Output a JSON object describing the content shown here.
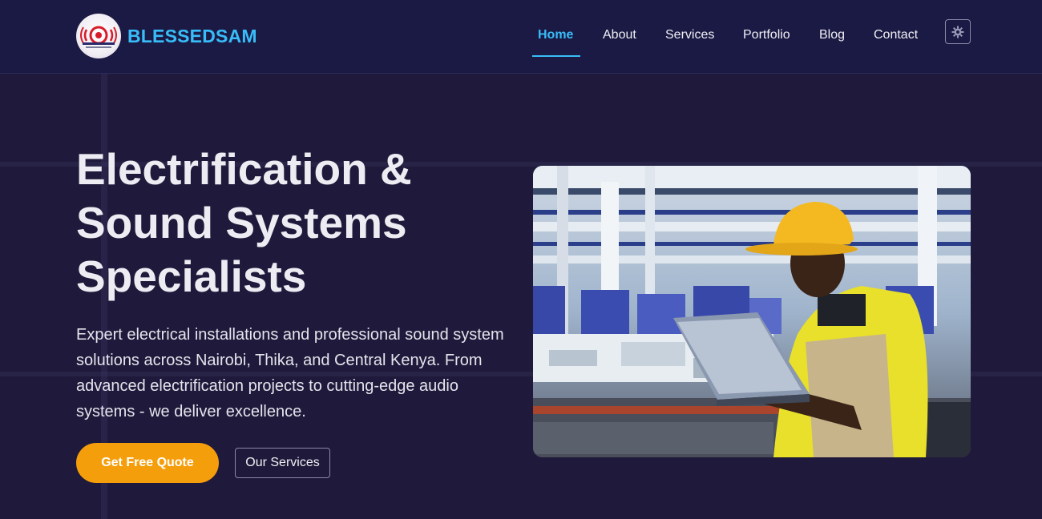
{
  "brand": {
    "name": "BLESSEDSAM",
    "logo_icon": "sound-wave-logo-icon"
  },
  "nav": {
    "items": [
      {
        "label": "Home",
        "active": true
      },
      {
        "label": "About",
        "active": false
      },
      {
        "label": "Services",
        "active": false
      },
      {
        "label": "Portfolio",
        "active": false
      },
      {
        "label": "Blog",
        "active": false
      },
      {
        "label": "Contact",
        "active": false
      }
    ],
    "theme_toggle_icon": "gear-icon"
  },
  "hero": {
    "title_lines": [
      "Electrification &",
      "Sound Systems",
      "Specialists"
    ],
    "description": "Expert electrical installations and professional sound system solutions across Nairobi, Thika, and Central Kenya. From advanced electrification projects to cutting-edge audio systems - we deliver excellence.",
    "primary_button": "Get Free Quote",
    "secondary_button": "Our Services",
    "image": "technician-with-laptop-photo"
  },
  "colors": {
    "accent": "#38bdf8",
    "cta": "#f59e0b",
    "navbar_bg": "#1b1a45",
    "hero_bg": "#1f1a3b"
  }
}
